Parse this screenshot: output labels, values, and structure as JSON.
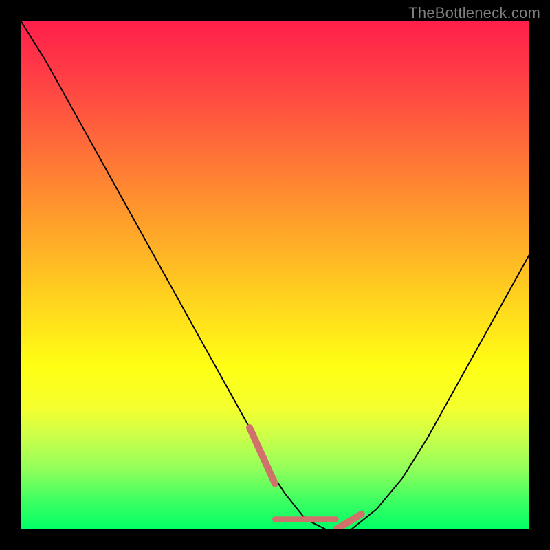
{
  "watermark": "TheBottleneck.com",
  "chart_data": {
    "type": "line",
    "title": "",
    "xlabel": "",
    "ylabel": "",
    "xlim": [
      0,
      100
    ],
    "ylim": [
      0,
      100
    ],
    "series": [
      {
        "name": "curve",
        "x": [
          0,
          5,
          10,
          15,
          20,
          25,
          30,
          35,
          40,
          45,
          48,
          52,
          56,
          60,
          62,
          65,
          70,
          75,
          80,
          85,
          90,
          95,
          100
        ],
        "y": [
          100,
          92,
          83,
          74,
          65,
          56,
          47,
          38,
          29,
          20,
          13,
          7,
          2,
          0,
          0,
          0,
          4,
          10,
          18,
          27,
          36,
          45,
          54
        ]
      }
    ],
    "highlight_segments": [
      {
        "name": "left-knee",
        "x": [
          45,
          50
        ],
        "y": [
          20,
          9
        ]
      },
      {
        "name": "right-knee",
        "x": [
          62,
          67
        ],
        "y": [
          0,
          3
        ]
      },
      {
        "name": "trough",
        "x": [
          50,
          62
        ],
        "y": [
          2,
          2
        ]
      }
    ]
  }
}
